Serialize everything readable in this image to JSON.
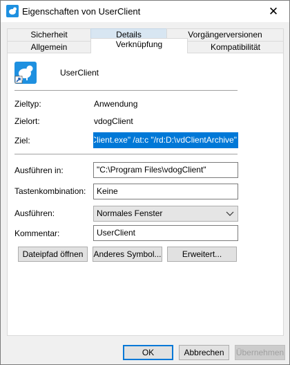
{
  "window": {
    "title": "Eigenschaften von UserClient",
    "close_symbol": "✕"
  },
  "tabs_top": [
    "Sicherheit",
    "Details",
    "Vorgängerversionen"
  ],
  "tabs_bottom": [
    "Allgemein",
    "Verknüpfung",
    "Kompatibilität"
  ],
  "active_tab": "Verknüpfung",
  "shortcut": {
    "name": "UserClient",
    "icon": "sheep-shortcut-icon"
  },
  "info": {
    "zieltyp_label": "Zieltyp:",
    "zieltyp_value": "Anwendung",
    "zielort_label": "Zielort:",
    "zielort_value": "vdogClient",
    "ziel_label": "Ziel:",
    "ziel_value": "gClient.exe\" /at:c \"/rd:D:\\vdClientArchive\""
  },
  "fields": {
    "ausfuehren_in_label": "Ausführen in:",
    "ausfuehren_in_value": "\"C:\\Program Files\\vdogClient\"",
    "tastenkombination_label": "Tastenkombination:",
    "tastenkombination_value": "Keine",
    "ausfuehren_label": "Ausführen:",
    "ausfuehren_value": "Normales Fenster",
    "kommentar_label": "Kommentar:",
    "kommentar_value": "UserClient"
  },
  "buttons": {
    "dateipfad": "Dateipfad öffnen",
    "symbol": "Anderes Symbol...",
    "erweitert": "Erweitert...",
    "ok": "OK",
    "abbrechen": "Abbrechen",
    "uebernehmen": "Übernehmen"
  },
  "colors": {
    "accent": "#0078d7",
    "tab_highlight": "#d8e6f2",
    "dialog_bg": "#f0f0f0"
  }
}
